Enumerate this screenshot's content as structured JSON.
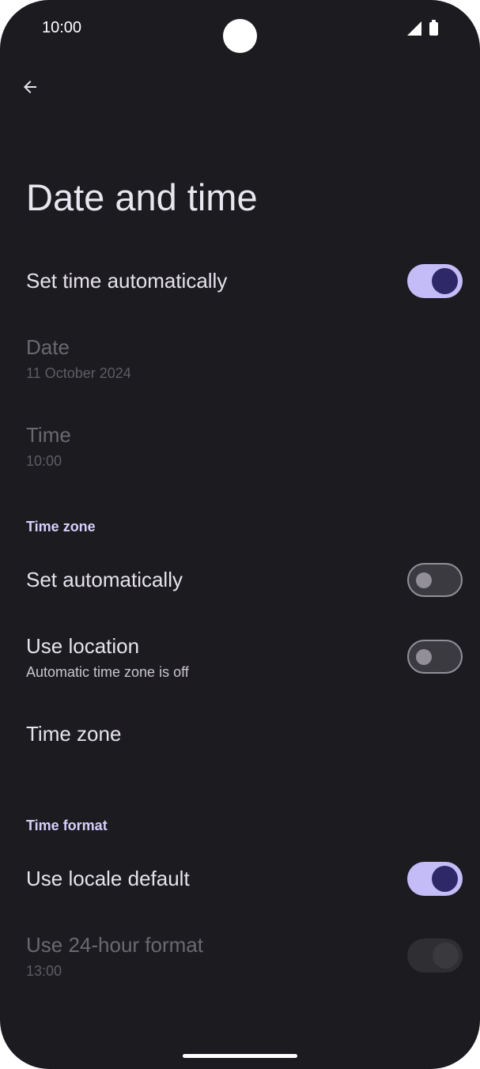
{
  "status_bar": {
    "time": "10:00"
  },
  "header": {
    "title": "Date and time"
  },
  "items": {
    "set_time_auto": {
      "title": "Set time automatically",
      "checked": true
    },
    "date": {
      "title": "Date",
      "summary": "11 October 2024",
      "enabled": false
    },
    "time": {
      "title": "Time",
      "summary": "10:00",
      "enabled": false
    },
    "timezone_header": "Time zone",
    "tz_set_auto": {
      "title": "Set automatically",
      "checked": false
    },
    "use_location": {
      "title": "Use location",
      "summary": "Automatic time zone is off",
      "checked": false
    },
    "time_zone": {
      "title": "Time zone"
    },
    "format_header": "Time format",
    "locale_default": {
      "title": "Use locale default",
      "checked": true
    },
    "use_24h": {
      "title": "Use 24-hour format",
      "summary": "13:00",
      "enabled": false
    }
  },
  "colors": {
    "background": "#1c1b20",
    "accent": "#c3bcf7",
    "accent_dark": "#2f2868",
    "section_header": "#d6cffb"
  },
  "icons": [
    "back-arrow-icon",
    "signal-icon",
    "battery-icon"
  ]
}
